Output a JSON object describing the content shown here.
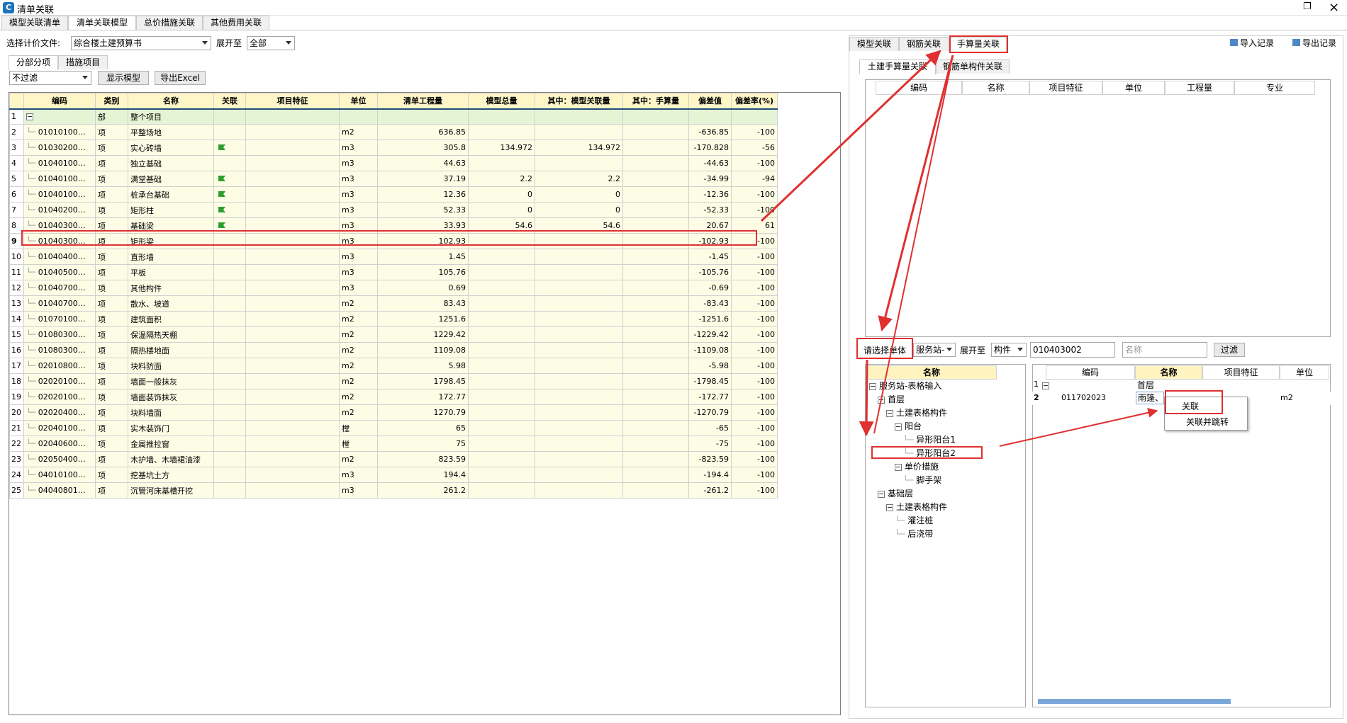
{
  "window": {
    "title": "清单关联",
    "restore_icon": "restore-icon",
    "close_icon": "close-icon"
  },
  "main_tabs": [
    "模型关联清单",
    "清单关联模型",
    "总价措施关联",
    "其他费用关联"
  ],
  "pricing_file": {
    "label": "选择计价文件:",
    "value": "综合楼土建预算书"
  },
  "expand": {
    "label": "展开至",
    "value": "全部"
  },
  "sub_tabs": [
    "分部分项",
    "措施项目"
  ],
  "filter": {
    "value": "不过滤"
  },
  "buttons": {
    "show_model": "显示模型",
    "export_excel": "导出Excel"
  },
  "left_table": {
    "headers": [
      "编码",
      "类别",
      "名称",
      "关联",
      "项目特征",
      "单位",
      "清单工程量",
      "模型总量",
      "其中：模型关联量",
      "其中：手算量",
      "偏差值",
      "偏差率(%)"
    ],
    "rows": [
      {
        "n": "1",
        "code": "",
        "type": "部",
        "name": "整个项目",
        "linked": false,
        "unit": "",
        "qty": "",
        "model": "",
        "mlink": "",
        "manual": "",
        "dev": "",
        "rate": ""
      },
      {
        "n": "2",
        "code": "01010100…",
        "type": "项",
        "name": "平整场地",
        "linked": false,
        "unit": "m2",
        "qty": "636.85",
        "model": "",
        "mlink": "",
        "manual": "",
        "dev": "-636.85",
        "rate": "-100"
      },
      {
        "n": "3",
        "code": "01030200…",
        "type": "项",
        "name": "实心砖墙",
        "linked": true,
        "unit": "m3",
        "qty": "305.8",
        "model": "134.972",
        "mlink": "134.972",
        "manual": "",
        "dev": "-170.828",
        "rate": "-56"
      },
      {
        "n": "4",
        "code": "01040100…",
        "type": "项",
        "name": "独立基础",
        "linked": false,
        "unit": "m3",
        "qty": "44.63",
        "model": "",
        "mlink": "",
        "manual": "",
        "dev": "-44.63",
        "rate": "-100"
      },
      {
        "n": "5",
        "code": "01040100…",
        "type": "项",
        "name": "满堂基础",
        "linked": true,
        "unit": "m3",
        "qty": "37.19",
        "model": "2.2",
        "mlink": "2.2",
        "manual": "",
        "dev": "-34.99",
        "rate": "-94"
      },
      {
        "n": "6",
        "code": "01040100…",
        "type": "项",
        "name": "桩承台基础",
        "linked": true,
        "unit": "m3",
        "qty": "12.36",
        "model": "0",
        "mlink": "0",
        "manual": "",
        "dev": "-12.36",
        "rate": "-100"
      },
      {
        "n": "7",
        "code": "01040200…",
        "type": "项",
        "name": "矩形柱",
        "linked": true,
        "unit": "m3",
        "qty": "52.33",
        "model": "0",
        "mlink": "0",
        "manual": "",
        "dev": "-52.33",
        "rate": "-100"
      },
      {
        "n": "8",
        "code": "01040300…",
        "type": "项",
        "name": "基础梁",
        "linked": true,
        "unit": "m3",
        "qty": "33.93",
        "model": "54.6",
        "mlink": "54.6",
        "manual": "",
        "dev": "20.67",
        "rate": "61"
      },
      {
        "n": "9",
        "code": "01040300…",
        "type": "项",
        "name": "矩形梁",
        "linked": false,
        "unit": "m3",
        "qty": "102.93",
        "model": "",
        "mlink": "",
        "manual": "",
        "dev": "-102.93",
        "rate": "-100"
      },
      {
        "n": "10",
        "code": "01040400…",
        "type": "项",
        "name": "直形墙",
        "linked": false,
        "unit": "m3",
        "qty": "1.45",
        "model": "",
        "mlink": "",
        "manual": "",
        "dev": "-1.45",
        "rate": "-100"
      },
      {
        "n": "11",
        "code": "01040500…",
        "type": "项",
        "name": "平板",
        "linked": false,
        "unit": "m3",
        "qty": "105.76",
        "model": "",
        "mlink": "",
        "manual": "",
        "dev": "-105.76",
        "rate": "-100"
      },
      {
        "n": "12",
        "code": "01040700…",
        "type": "项",
        "name": "其他构件",
        "linked": false,
        "unit": "m3",
        "qty": "0.69",
        "model": "",
        "mlink": "",
        "manual": "",
        "dev": "-0.69",
        "rate": "-100"
      },
      {
        "n": "13",
        "code": "01040700…",
        "type": "项",
        "name": "散水、坡道",
        "linked": false,
        "unit": "m2",
        "qty": "83.43",
        "model": "",
        "mlink": "",
        "manual": "",
        "dev": "-83.43",
        "rate": "-100"
      },
      {
        "n": "14",
        "code": "01070100…",
        "type": "项",
        "name": "建筑面积",
        "linked": false,
        "unit": "m2",
        "qty": "1251.6",
        "model": "",
        "mlink": "",
        "manual": "",
        "dev": "-1251.6",
        "rate": "-100"
      },
      {
        "n": "15",
        "code": "01080300…",
        "type": "项",
        "name": "保温隔热天棚",
        "linked": false,
        "unit": "m2",
        "qty": "1229.42",
        "model": "",
        "mlink": "",
        "manual": "",
        "dev": "-1229.42",
        "rate": "-100"
      },
      {
        "n": "16",
        "code": "01080300…",
        "type": "项",
        "name": "隔热楼地面",
        "linked": false,
        "unit": "m2",
        "qty": "1109.08",
        "model": "",
        "mlink": "",
        "manual": "",
        "dev": "-1109.08",
        "rate": "-100"
      },
      {
        "n": "17",
        "code": "02010800…",
        "type": "项",
        "name": "块料防面",
        "linked": false,
        "unit": "m2",
        "qty": "5.98",
        "model": "",
        "mlink": "",
        "manual": "",
        "dev": "-5.98",
        "rate": "-100"
      },
      {
        "n": "18",
        "code": "02020100…",
        "type": "项",
        "name": "墙面一般抹灰",
        "linked": false,
        "unit": "m2",
        "qty": "1798.45",
        "model": "",
        "mlink": "",
        "manual": "",
        "dev": "-1798.45",
        "rate": "-100"
      },
      {
        "n": "19",
        "code": "02020100…",
        "type": "项",
        "name": "墙面装饰抹灰",
        "linked": false,
        "unit": "m2",
        "qty": "172.77",
        "model": "",
        "mlink": "",
        "manual": "",
        "dev": "-172.77",
        "rate": "-100"
      },
      {
        "n": "20",
        "code": "02020400…",
        "type": "项",
        "name": "块料墙面",
        "linked": false,
        "unit": "m2",
        "qty": "1270.79",
        "model": "",
        "mlink": "",
        "manual": "",
        "dev": "-1270.79",
        "rate": "-100"
      },
      {
        "n": "21",
        "code": "02040100…",
        "type": "项",
        "name": "实木装饰门",
        "linked": false,
        "unit": "樘",
        "qty": "65",
        "model": "",
        "mlink": "",
        "manual": "",
        "dev": "-65",
        "rate": "-100"
      },
      {
        "n": "22",
        "code": "02040600…",
        "type": "项",
        "name": "金属推拉窗",
        "linked": false,
        "unit": "樘",
        "qty": "75",
        "model": "",
        "mlink": "",
        "manual": "",
        "dev": "-75",
        "rate": "-100"
      },
      {
        "n": "23",
        "code": "02050400…",
        "type": "项",
        "name": "木护墙、木墙裙油漆",
        "linked": false,
        "unit": "m2",
        "qty": "823.59",
        "model": "",
        "mlink": "",
        "manual": "",
        "dev": "-823.59",
        "rate": "-100"
      },
      {
        "n": "24",
        "code": "04010100…",
        "type": "项",
        "name": "挖基坑土方",
        "linked": false,
        "unit": "m3",
        "qty": "194.4",
        "model": "",
        "mlink": "",
        "manual": "",
        "dev": "-194.4",
        "rate": "-100"
      },
      {
        "n": "25",
        "code": "04040801…",
        "type": "项",
        "name": "沉管河床基槽开挖",
        "linked": false,
        "unit": "m3",
        "qty": "261.2",
        "model": "",
        "mlink": "",
        "manual": "",
        "dev": "-261.2",
        "rate": "-100"
      }
    ]
  },
  "right_tabs": [
    "模型关联",
    "钢筋关联",
    "手算量关联"
  ],
  "import_record": "导入记录",
  "export_record": "导出记录",
  "right_sub_tabs": [
    "土建手算量关联",
    "钢筋单构件关联"
  ],
  "upper_table_headers": [
    "编码",
    "名称",
    "项目特征",
    "单位",
    "工程量",
    "专业"
  ],
  "select_unit_label": "请选择单体",
  "unit_select": "服务站-",
  "expand2": {
    "label": "展开至",
    "value": "构件"
  },
  "code_filter": "010403002",
  "name_placeholder": "名称",
  "filter_button": "过滤",
  "tree_header": "名称",
  "tree": [
    {
      "level": 0,
      "box": true,
      "text": "服务站-表格输入"
    },
    {
      "level": 1,
      "box": true,
      "text": "首层"
    },
    {
      "level": 2,
      "box": true,
      "text": "土建表格构件"
    },
    {
      "level": 3,
      "box": true,
      "text": "阳台"
    },
    {
      "level": 4,
      "box": false,
      "text": "异形阳台1"
    },
    {
      "level": 4,
      "box": false,
      "text": "异形阳台2"
    },
    {
      "level": 3,
      "box": true,
      "text": "单价措施"
    },
    {
      "level": 4,
      "box": false,
      "text": "脚手架"
    },
    {
      "level": 1,
      "box": true,
      "text": "基础层"
    },
    {
      "level": 2,
      "box": true,
      "text": "土建表格构件"
    },
    {
      "level": 3,
      "box": false,
      "text": "灌注桩"
    },
    {
      "level": 3,
      "box": false,
      "text": "后浇带"
    }
  ],
  "lower_table": {
    "headers": [
      "编码",
      "名称",
      "项目特征",
      "单位"
    ],
    "rows": [
      {
        "n": "1",
        "code": "",
        "name": "首层",
        "unit": ""
      },
      {
        "n": "2",
        "code": "011702023",
        "name": "雨篷、",
        "unit": "m2"
      }
    ]
  },
  "context_menu": [
    "关联",
    "关联并跳转"
  ],
  "colors": {
    "highlight": "#e03030",
    "header_yellow": "#fff6c8",
    "row_yellow": "#fdfde6",
    "row_green": "#e6f4d6",
    "scroll_blue": "#7aa7d8"
  }
}
